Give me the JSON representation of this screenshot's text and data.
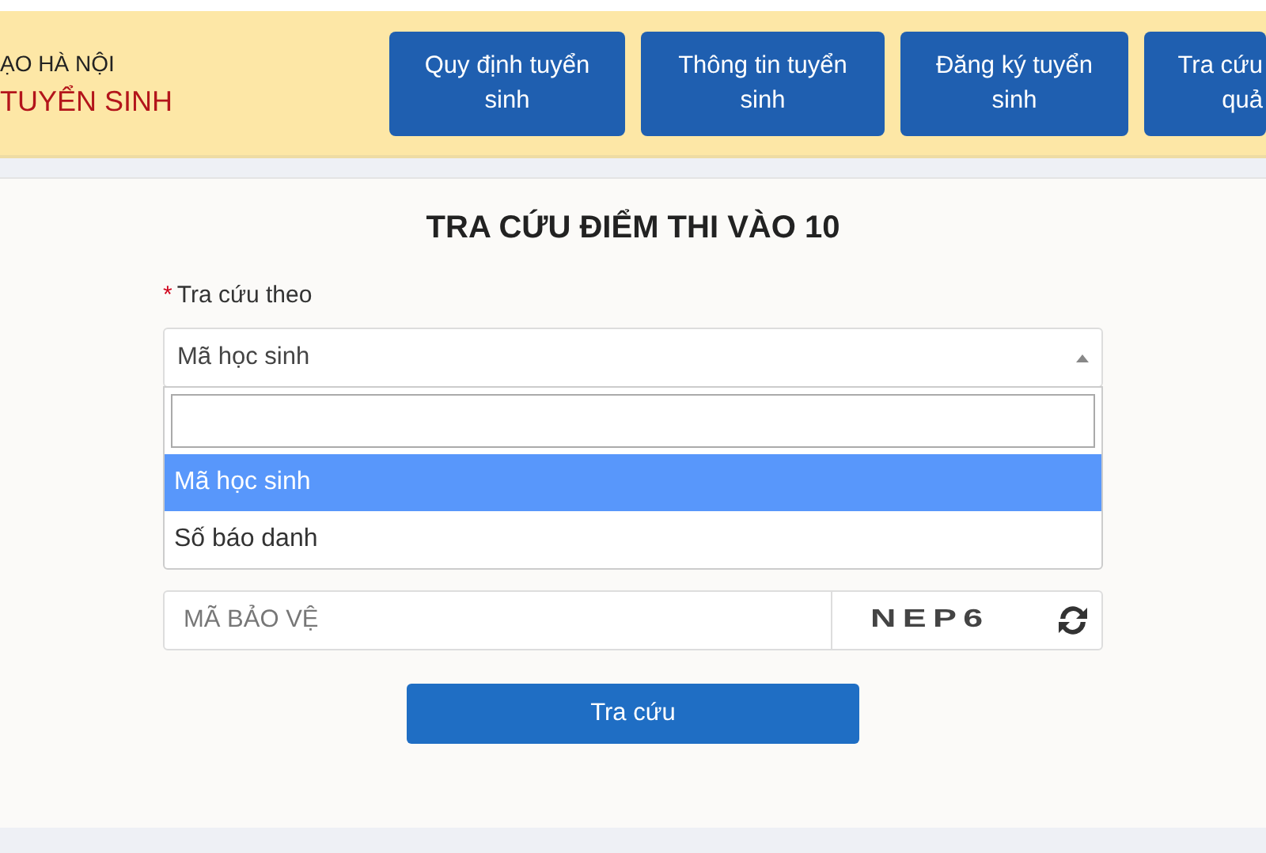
{
  "header": {
    "org_line": "ẠO HÀ NỘI",
    "site_title": "TUYỂN SINH"
  },
  "nav": [
    {
      "lines": [
        "Quy định tuyển",
        "sinh"
      ]
    },
    {
      "lines": [
        "Thông tin tuyển",
        "sinh"
      ]
    },
    {
      "lines": [
        "Đăng ký tuyển",
        "sinh"
      ]
    },
    {
      "lines": [
        "Tra cứu",
        "quả"
      ]
    }
  ],
  "form": {
    "title": "TRA CỨU ĐIỂM THI VÀO 10",
    "required_mark": "*",
    "label": "Tra cứu theo",
    "select_value": "Mã học sinh",
    "expanded": true,
    "options": [
      {
        "label": "Mã học sinh",
        "selected": true
      },
      {
        "label": "Số báo danh",
        "selected": false
      }
    ],
    "captcha_placeholder": "MÃ BẢO VỆ",
    "captcha_code": "NEP6",
    "submit": "Tra cứu"
  }
}
